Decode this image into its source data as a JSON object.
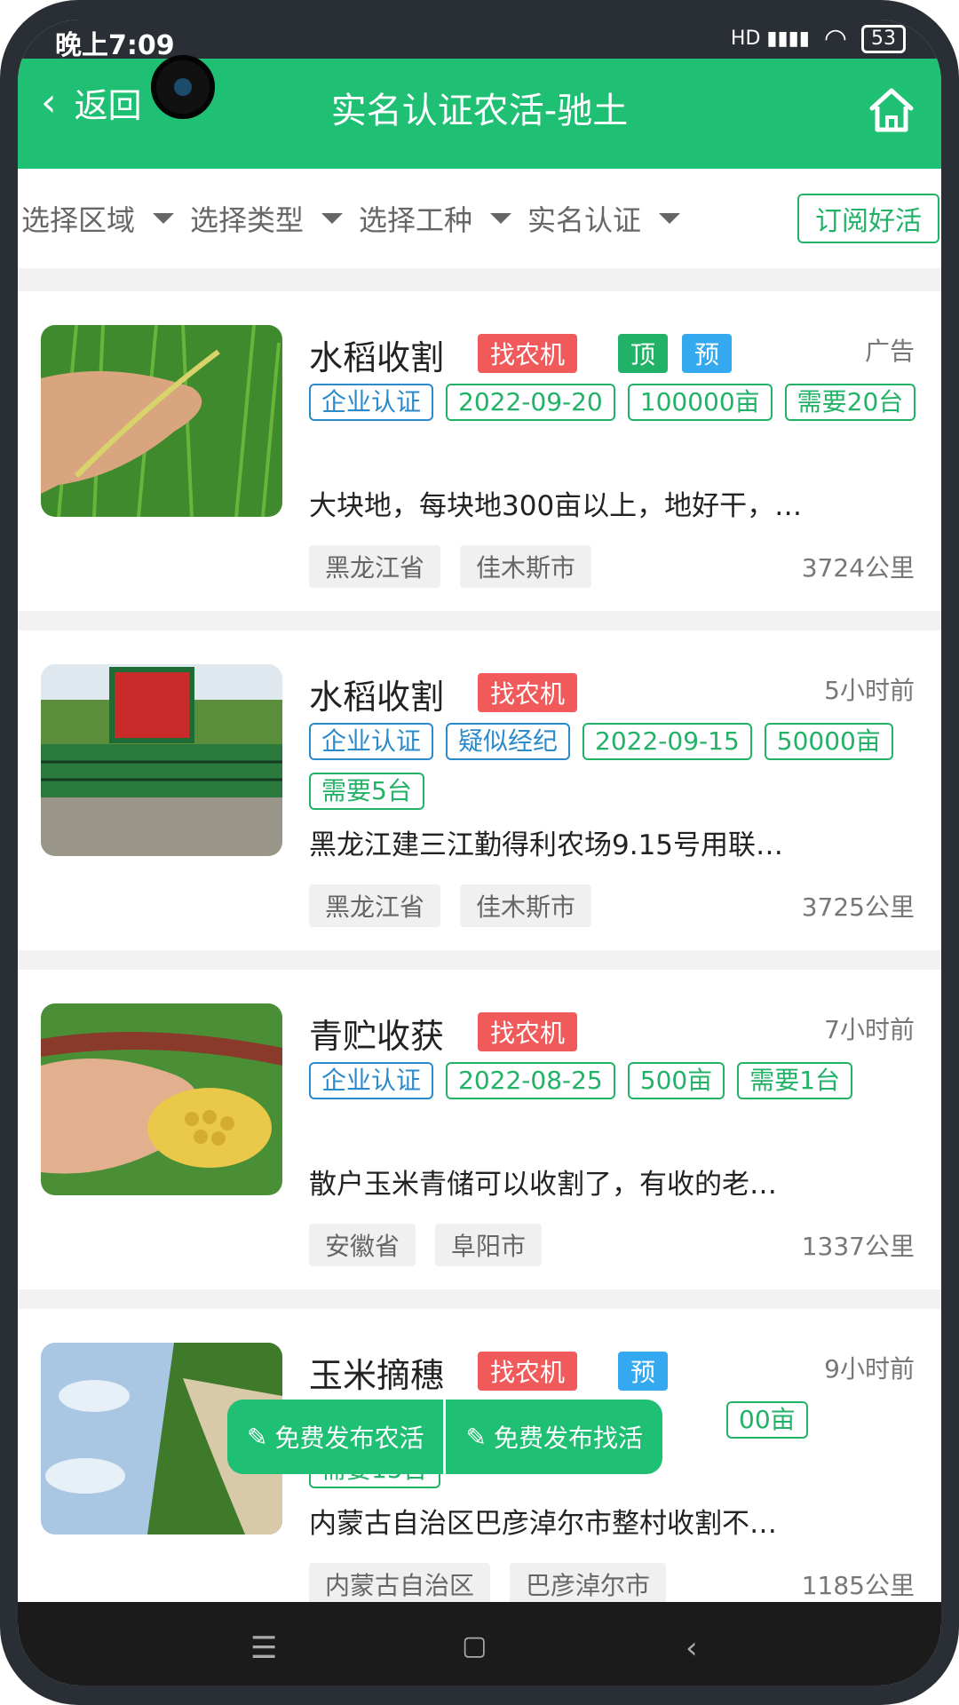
{
  "status_bar": {
    "time": "晚上7:09",
    "network": "HD",
    "battery": "53"
  },
  "header": {
    "back_label": "返回",
    "title": "实名认证农活-驰土",
    "home_icon": "home-icon"
  },
  "filters": {
    "items": [
      "选择区域",
      "选择类型",
      "选择工种",
      "实名认证"
    ],
    "subscribe_label": "订阅好活"
  },
  "listings": [
    {
      "title": "水稻收割",
      "type_tag": "找农机",
      "extra_tags": [
        "顶",
        "预"
      ],
      "meta": "广告",
      "tags": [
        "企业认证",
        "2022-09-20",
        "100000亩",
        "需要20台"
      ],
      "description": "大块地，每块地300亩以上，地好干，…",
      "province": "黑龙江省",
      "city": "佳木斯市",
      "distance": "3724公里"
    },
    {
      "title": "水稻收割",
      "type_tag": "找农机",
      "extra_tags": [],
      "meta": "5小时前",
      "tags": [
        "企业认证",
        "疑似经纪",
        "2022-09-15",
        "50000亩",
        "需要5台"
      ],
      "description": "黑龙江建三江勤得利农场9.15号用联…",
      "province": "黑龙江省",
      "city": "佳木斯市",
      "distance": "3725公里"
    },
    {
      "title": "青贮收获",
      "type_tag": "找农机",
      "extra_tags": [],
      "meta": "7小时前",
      "tags": [
        "企业认证",
        "2022-08-25",
        "500亩",
        "需要1台"
      ],
      "description": "散户玉米青储可以收割了，有收的老…",
      "province": "安徽省",
      "city": "阜阳市",
      "distance": "1337公里"
    },
    {
      "title": "玉米摘穗",
      "type_tag": "找农机",
      "extra_tags": [
        "预"
      ],
      "meta": "9小时前",
      "tags": [
        "00亩",
        "需要15台"
      ],
      "description": "内蒙古自治区巴彦淖尔市整村收割不…",
      "province": "内蒙古自治区",
      "city": "巴彦淖尔市",
      "distance": "1185公里"
    }
  ],
  "fab": {
    "publish_job": "免费发布农活",
    "find_job": "免费发布找活"
  },
  "colors": {
    "primary": "#1fbf74",
    "red_tag": "#f05a5a",
    "blue_tag": "#34a9f0",
    "outline_blue": "#2b8acb"
  }
}
